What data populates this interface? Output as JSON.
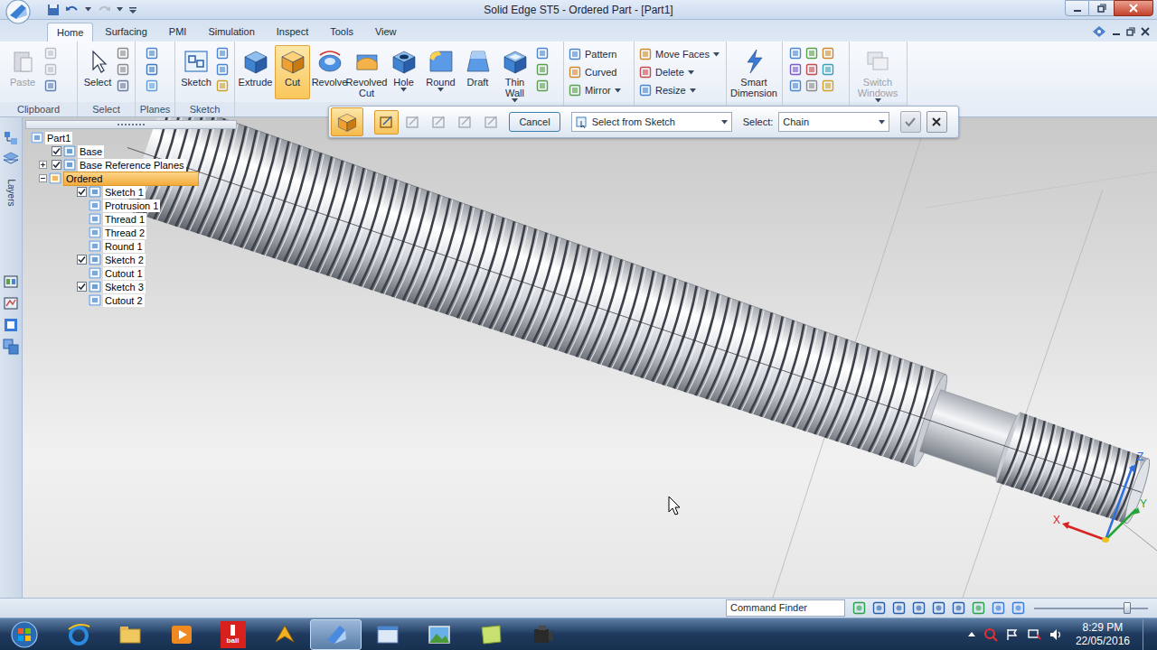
{
  "window": {
    "title": "Solid Edge ST5 - Ordered Part - [Part1]"
  },
  "tabs": [
    {
      "label": "Home",
      "selected": true
    },
    {
      "label": "Surfacing",
      "selected": false
    },
    {
      "label": "PMI",
      "selected": false
    },
    {
      "label": "Simulation",
      "selected": false
    },
    {
      "label": "Inspect",
      "selected": false
    },
    {
      "label": "Tools",
      "selected": false
    },
    {
      "label": "View",
      "selected": false
    }
  ],
  "ribbon": {
    "clipboard": {
      "label": "Clipboard",
      "paste": {
        "label": "Paste",
        "disabled": true
      }
    },
    "select": {
      "label": "Select",
      "button": {
        "label": "Select"
      }
    },
    "planes": {
      "label": "Planes"
    },
    "sketch": {
      "label": "Sketch",
      "button": {
        "label": "Sketch"
      }
    },
    "solids": [
      {
        "label": "Extrude",
        "selected": false,
        "dropdown": false
      },
      {
        "label": "Cut",
        "selected": true,
        "dropdown": false
      },
      {
        "label": "Revolve",
        "selected": false,
        "dropdown": false
      },
      {
        "label": "Revolved Cut",
        "selected": false,
        "dropdown": false
      },
      {
        "label": "Hole",
        "selected": false,
        "dropdown": true
      },
      {
        "label": "Round",
        "selected": false,
        "dropdown": true
      },
      {
        "label": "Draft",
        "selected": false,
        "dropdown": false
      },
      {
        "label": "Thin Wall",
        "selected": false,
        "dropdown": true
      }
    ],
    "pattern": [
      {
        "label": "Pattern",
        "dropdown": false
      },
      {
        "label": "Curved",
        "dropdown": false
      },
      {
        "label": "Mirror",
        "dropdown": true
      }
    ],
    "modify": [
      {
        "label": "Move Faces",
        "dropdown": true
      },
      {
        "label": "Delete",
        "dropdown": true
      },
      {
        "label": "Resize",
        "dropdown": true
      }
    ],
    "dimension": {
      "label": "Smart Dimension"
    },
    "windows": {
      "label": "Switch Windows",
      "disabled": true
    }
  },
  "command_bar": {
    "steps": [
      {
        "selected": true
      },
      {
        "selected": false
      },
      {
        "selected": false
      },
      {
        "selected": false
      },
      {
        "selected": false
      }
    ],
    "cancel": "Cancel",
    "select_from": "Select from Sketch",
    "select_label": "Select:",
    "select_value": "Chain"
  },
  "pathfinder": {
    "items": [
      {
        "label": "Part1",
        "level": 0,
        "kind": "plain",
        "expandable": false,
        "expanded": false,
        "selected": false
      },
      {
        "label": "Base",
        "level": 1,
        "kind": "checkable",
        "checked": true,
        "expandable": false,
        "expanded": false,
        "selected": false
      },
      {
        "label": "Base Reference Planes",
        "level": 1,
        "kind": "checkable",
        "checked": true,
        "expandable": true,
        "expanded": false,
        "selected": false
      },
      {
        "label": "Ordered",
        "level": 1,
        "kind": "plain",
        "expandable": true,
        "expanded": true,
        "selected": true
      },
      {
        "label": "Sketch 1",
        "level": 2,
        "kind": "checkable",
        "checked": true,
        "expandable": false,
        "expanded": false,
        "selected": false
      },
      {
        "label": "Protrusion 1",
        "level": 2,
        "kind": "plain",
        "expandable": false,
        "expanded": false,
        "selected": false
      },
      {
        "label": "Thread 1",
        "level": 2,
        "kind": "plain",
        "expandable": false,
        "expanded": false,
        "selected": false
      },
      {
        "label": "Thread 2",
        "level": 2,
        "kind": "plain",
        "expandable": false,
        "expanded": false,
        "selected": false
      },
      {
        "label": "Round 1",
        "level": 2,
        "kind": "plain",
        "expandable": false,
        "expanded": false,
        "selected": false
      },
      {
        "label": "Sketch 2",
        "level": 2,
        "kind": "checkable",
        "checked": true,
        "expandable": false,
        "expanded": false,
        "selected": false
      },
      {
        "label": "Cutout 1",
        "level": 2,
        "kind": "plain",
        "expandable": false,
        "expanded": false,
        "selected": false
      },
      {
        "label": "Sketch 3",
        "level": 2,
        "kind": "checkable",
        "checked": true,
        "expandable": false,
        "expanded": false,
        "selected": false
      },
      {
        "label": "Cutout 2",
        "level": 2,
        "kind": "plain",
        "expandable": false,
        "expanded": false,
        "selected": false
      }
    ]
  },
  "left_strip": {
    "layers_label": "Layers"
  },
  "axes": [
    {
      "label": "Z",
      "color": "#2f6fe0"
    },
    {
      "label": "X",
      "color": "#d92323"
    },
    {
      "label": "Y",
      "color": "#27a33a"
    }
  ],
  "status_bar": {
    "command_finder": "Command Finder",
    "zoom_level": 0.82
  },
  "taskbar": {
    "apps": [
      {
        "kind": "ie",
        "label": "",
        "active": false
      },
      {
        "kind": "explorer",
        "label": "",
        "active": false
      },
      {
        "kind": "media",
        "label": "",
        "active": false
      },
      {
        "kind": "iball",
        "label": "ball",
        "active": false
      },
      {
        "kind": "arrow",
        "label": "",
        "active": false
      },
      {
        "kind": "solidedge",
        "label": "",
        "active": true
      },
      {
        "kind": "window",
        "label": "",
        "active": false
      },
      {
        "kind": "photo",
        "label": "",
        "active": false
      },
      {
        "kind": "notes",
        "label": "",
        "active": false
      },
      {
        "kind": "camera",
        "label": "",
        "active": false
      }
    ],
    "clock": {
      "time": "8:29 PM",
      "date": "22/05/2016"
    }
  }
}
